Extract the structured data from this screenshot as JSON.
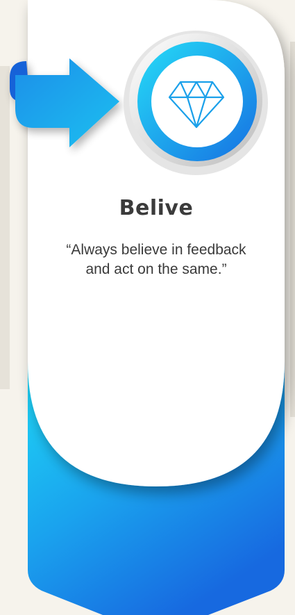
{
  "card": {
    "title": "Belive",
    "quote_line1": "“Always believe in feedback",
    "quote_line2": "and act on the same.”"
  },
  "icons": {
    "badge": "diamond-icon",
    "pointer": "arrow-right-icon"
  },
  "colors": {
    "background": "#f6f3ec",
    "accent_light": "#1fd3f5",
    "accent_dark": "#1769e0",
    "text": "#3b3b3b"
  }
}
